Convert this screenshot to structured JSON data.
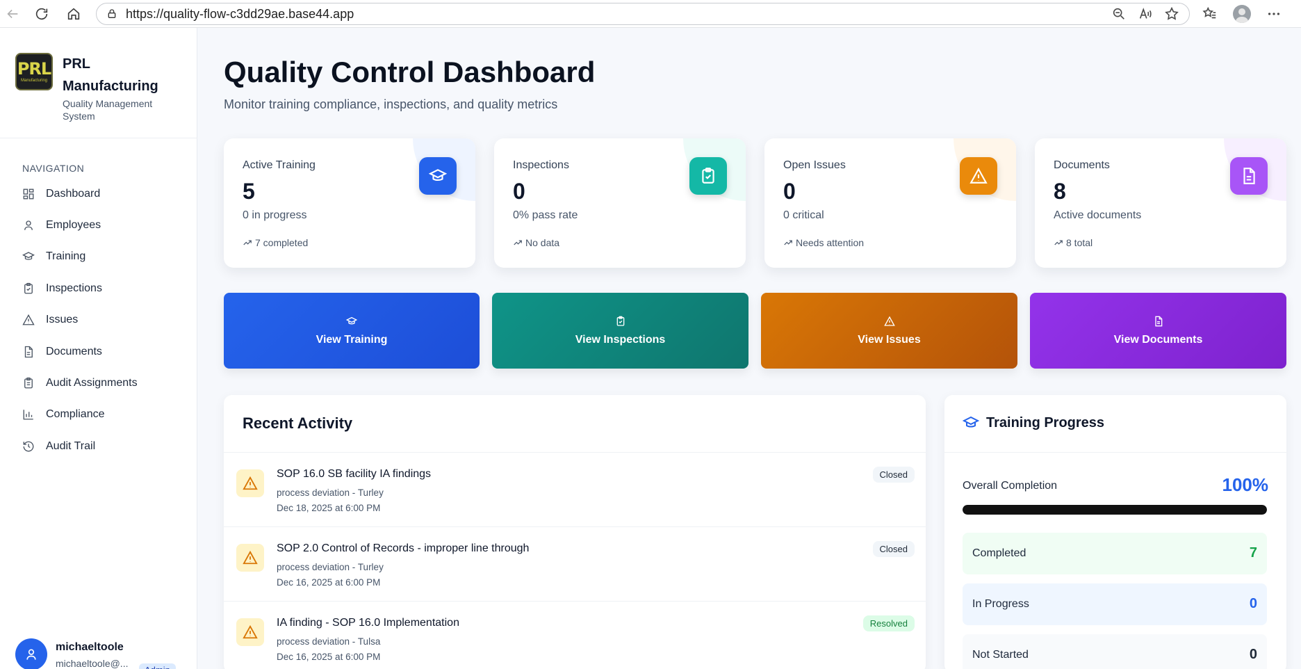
{
  "browser": {
    "url": "https://quality-flow-c3dd29ae.base44.app"
  },
  "sidebar": {
    "brand_name": "PRL Manufacturing",
    "brand_sub": "Quality Management System",
    "logo_text": "PRL",
    "logo_subtext": "Manufacturing",
    "nav_heading": "NAVIGATION",
    "items": [
      {
        "label": "Dashboard",
        "icon": "grid-icon"
      },
      {
        "label": "Employees",
        "icon": "user-icon"
      },
      {
        "label": "Training",
        "icon": "graduation-cap-icon"
      },
      {
        "label": "Inspections",
        "icon": "clipboard-check-icon"
      },
      {
        "label": "Issues",
        "icon": "alert-triangle-icon"
      },
      {
        "label": "Documents",
        "icon": "file-text-icon"
      },
      {
        "label": "Audit Assignments",
        "icon": "clipboard-list-icon"
      },
      {
        "label": "Compliance",
        "icon": "bar-chart-icon"
      },
      {
        "label": "Audit Trail",
        "icon": "history-icon"
      }
    ],
    "user": {
      "name": "michaeltoole",
      "email": "michaeltoole@...",
      "role": "Admin"
    }
  },
  "header": {
    "title": "Quality Control Dashboard",
    "subtitle": "Monitor training compliance, inspections, and quality metrics"
  },
  "stats": [
    {
      "label": "Active Training",
      "value": "5",
      "sub": "0 in progress",
      "trend": "7 completed",
      "icon": "graduation-cap-icon",
      "color": "#2563eb"
    },
    {
      "label": "Inspections",
      "value": "0",
      "sub": "0% pass rate",
      "trend": "No data",
      "icon": "clipboard-check-icon",
      "color": "#0d9488"
    },
    {
      "label": "Open Issues",
      "value": "0",
      "sub": "0 critical",
      "trend": "Needs attention",
      "icon": "alert-triangle-icon",
      "color": "#ea8a0b"
    },
    {
      "label": "Documents",
      "value": "8",
      "sub": "Active documents",
      "trend": "8 total",
      "icon": "file-text-icon",
      "color": "#a855f7"
    }
  ],
  "actions": [
    {
      "label": "View Training",
      "icon": "graduation-cap-icon"
    },
    {
      "label": "View Inspections",
      "icon": "clipboard-check-icon"
    },
    {
      "label": "View Issues",
      "icon": "alert-triangle-icon"
    },
    {
      "label": "View Documents",
      "icon": "file-text-icon"
    }
  ],
  "recent_activity": {
    "title": "Recent Activity",
    "items": [
      {
        "title": "SOP 16.0 SB facility IA findings",
        "meta": "process deviation - Turley",
        "date": "Dec 18, 2025 at 6:00 PM",
        "status": "Closed"
      },
      {
        "title": "SOP 2.0 Control of Records - improper line through",
        "meta": "process deviation - Turley",
        "date": "Dec 16, 2025 at 6:00 PM",
        "status": "Closed"
      },
      {
        "title": "IA finding - SOP 16.0 Implementation",
        "meta": "process deviation - Tulsa",
        "date": "Dec 16, 2025 at 6:00 PM",
        "status": "Resolved"
      }
    ]
  },
  "training_progress": {
    "title": "Training Progress",
    "overall_label": "Overall Completion",
    "overall_value": "100%",
    "overall_fraction": 1.0,
    "rows": [
      {
        "label": "Completed",
        "value": "7",
        "color": "#16a34a",
        "bg": "#f0fdf4"
      },
      {
        "label": "In Progress",
        "value": "0",
        "color": "#2563eb",
        "bg": "#eff6ff"
      },
      {
        "label": "Not Started",
        "value": "0",
        "color": "#1f2937",
        "bg": "#f8fafc"
      }
    ]
  }
}
